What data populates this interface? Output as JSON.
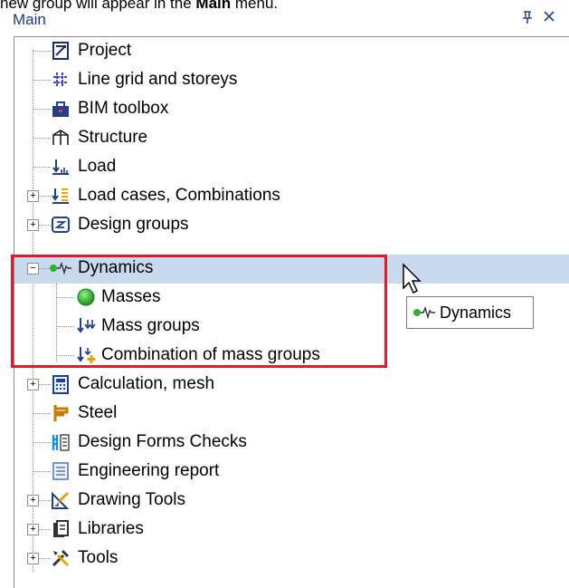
{
  "caption": {
    "prefix": "new group will appear in the ",
    "bold": "Main",
    "suffix": " menu."
  },
  "panel": {
    "title": "Main",
    "pin_glyph": "ᵖ",
    "close_glyph": "✕"
  },
  "tree": [
    {
      "label": "Project",
      "icon": "project-icon",
      "expander": ""
    },
    {
      "label": "Line grid and storeys",
      "icon": "line-grid-icon",
      "expander": ""
    },
    {
      "label": "BIM toolbox",
      "icon": "bim-toolbox-icon",
      "expander": ""
    },
    {
      "label": "Structure",
      "icon": "structure-icon",
      "expander": ""
    },
    {
      "label": "Load",
      "icon": "load-icon",
      "expander": ""
    },
    {
      "label": "Load cases, Combinations",
      "icon": "load-cases-icon",
      "expander": "+"
    },
    {
      "label": "Design groups",
      "icon": "design-groups-icon",
      "expander": "+"
    },
    {
      "label": "Dynamics",
      "icon": "dynamics-icon",
      "expander": "−"
    },
    {
      "label": "Masses",
      "icon": "masses-icon",
      "expander": ""
    },
    {
      "label": "Mass groups",
      "icon": "mass-groups-icon",
      "expander": ""
    },
    {
      "label": "Combination of mass groups",
      "icon": "combination-mass-groups-icon",
      "expander": ""
    },
    {
      "label": "Calculation, mesh",
      "icon": "calculation-icon",
      "expander": "+"
    },
    {
      "label": "Steel",
      "icon": "steel-icon",
      "expander": ""
    },
    {
      "label": "Design Forms Checks",
      "icon": "design-forms-icon",
      "expander": ""
    },
    {
      "label": "Engineering report",
      "icon": "engineering-report-icon",
      "expander": ""
    },
    {
      "label": "Drawing Tools",
      "icon": "drawing-tools-icon",
      "expander": "+"
    },
    {
      "label": "Libraries",
      "icon": "libraries-icon",
      "expander": "+"
    },
    {
      "label": "Tools",
      "icon": "tools-icon",
      "expander": "+"
    }
  ],
  "tooltip": {
    "label": "Dynamics",
    "icon": "dynamics-icon"
  },
  "colors": {
    "selection": "#c9d9ee",
    "highlight_box": "#e01c2a"
  }
}
